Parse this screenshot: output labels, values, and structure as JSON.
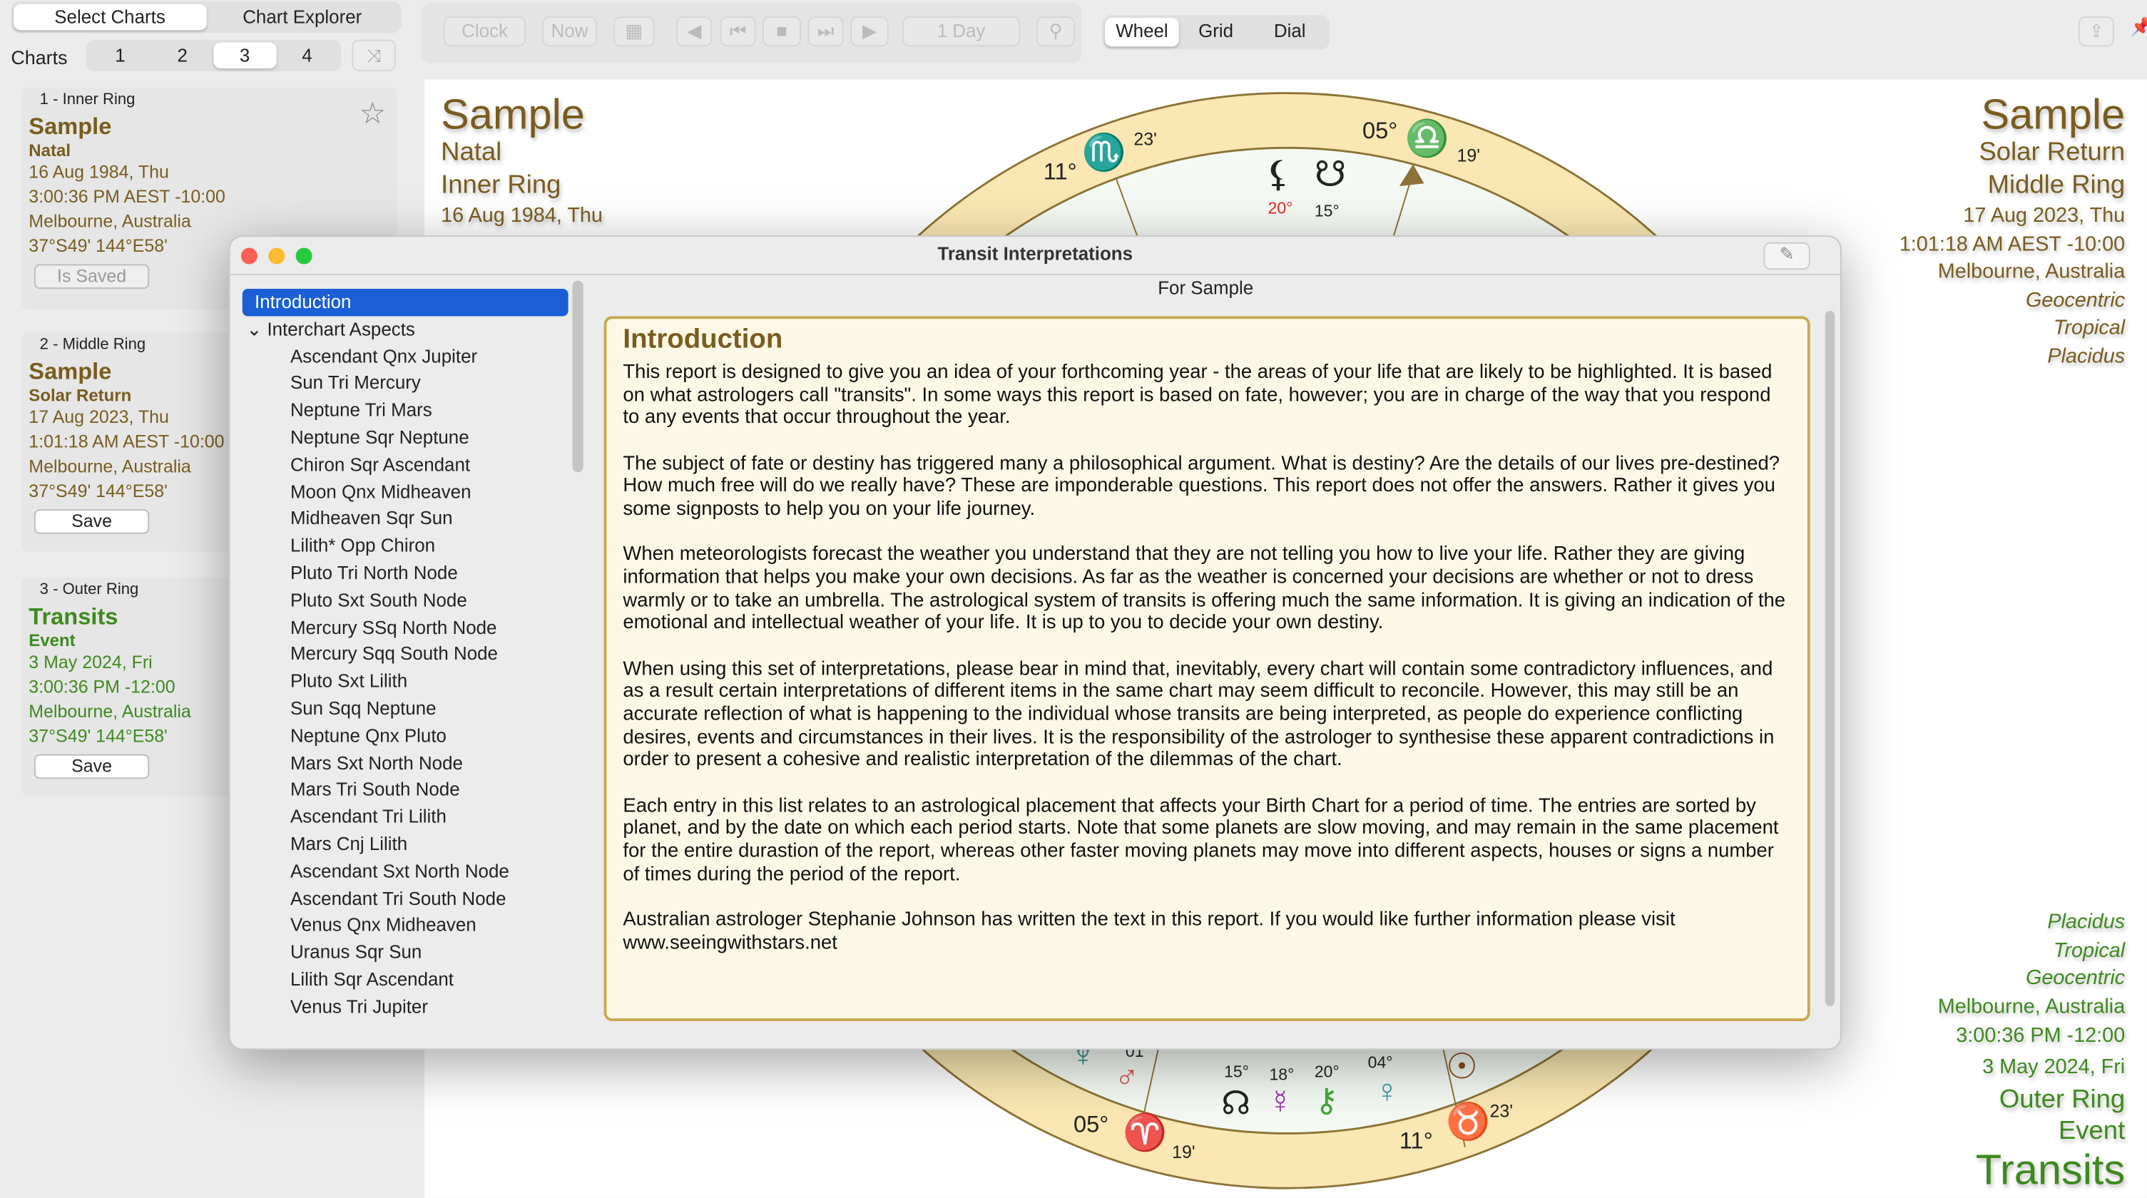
{
  "top_tabs": [
    "Select Charts",
    "Chart Explorer"
  ],
  "charts_label": "Charts",
  "chart_numbers": [
    "1",
    "2",
    "3",
    "4"
  ],
  "toolbar": {
    "clock": "Clock",
    "now": "Now",
    "step": "1 Day",
    "views": [
      "Wheel",
      "Grid",
      "Dial"
    ]
  },
  "cards": [
    {
      "ring": "1 - Inner Ring",
      "name": "Sample",
      "type": "Natal",
      "date": "16 Aug 1984, Thu",
      "time": "3:00:36 PM AEST -10:00",
      "place": "Melbourne, Australia",
      "coords": "37°S49' 144°E58'",
      "button": "Is Saved"
    },
    {
      "ring": "2 - Middle Ring",
      "name": "Sample",
      "type": "Solar Return",
      "date": "17 Aug 2023, Thu",
      "time": "1:01:18 AM AEST -10:00",
      "place": "Melbourne, Australia",
      "coords": "37°S49' 144°E58'",
      "button": "Save"
    },
    {
      "ring": "3 - Outer Ring",
      "name": "Transits",
      "type": "Event",
      "date": "3 May 2024, Fri",
      "time": "3:00:36 PM -12:00",
      "place": "Melbourne, Australia",
      "coords": "37°S49' 144°E58'",
      "button": "Save"
    }
  ],
  "left_title": {
    "name": "Sample",
    "type": "Natal",
    "ring": "Inner Ring",
    "date": "16 Aug 1984, Thu"
  },
  "right_top": {
    "name": "Sample",
    "type": "Solar Return",
    "ring": "Middle Ring",
    "date": "17 Aug 2023, Thu",
    "time": "1:01:18 AM AEST -10:00",
    "place": "Melbourne, Australia",
    "zodiac": "Geocentric",
    "mode": "Tropical",
    "houses": "Placidus"
  },
  "right_bottom": {
    "houses": "Placidus",
    "mode": "Tropical",
    "zodiac": "Geocentric",
    "place": "Melbourne, Australia",
    "time": "3:00:36 PM -12:00",
    "date": "3 May 2024, Fri",
    "ring": "Outer Ring",
    "type": "Event",
    "name": "Transits"
  },
  "wheel": {
    "top": [
      "11°",
      "23'",
      "05°",
      "19'",
      "20°",
      "15°"
    ],
    "bottom": [
      "05°",
      "19'",
      "11°",
      "23'",
      "15°",
      "18°",
      "20°",
      "04°",
      "01°"
    ]
  },
  "dialog": {
    "title": "Transit Interpretations",
    "subtitle": "For Sample",
    "list": [
      "Introduction",
      "Interchart Aspects",
      "Ascendant Qnx Jupiter",
      "Sun Tri Mercury",
      "Neptune Tri Mars",
      "Neptune Sqr Neptune",
      "Chiron Sqr Ascendant",
      "Moon Qnx Midheaven",
      "Midheaven Sqr Sun",
      "Lilith* Opp Chiron",
      "Pluto Tri North Node",
      "Pluto Sxt South Node",
      "Mercury SSq North Node",
      "Mercury Sqq South Node",
      "Pluto Sxt Lilith",
      "Sun Sqq Neptune",
      "Neptune Qnx Pluto",
      "Mars Sxt North Node",
      "Mars Tri South Node",
      "Ascendant Tri Lilith",
      "Mars Cnj Lilith",
      "Ascendant Sxt North Node",
      "Ascendant Tri South Node",
      "Venus Qnx Midheaven",
      "Uranus Sqr Sun",
      "Lilith Sqr Ascendant",
      "Venus Tri Jupiter"
    ],
    "heading": "Introduction",
    "paragraphs": [
      "This report is designed to give you an idea of your forthcoming year - the areas of your life that are likely to be highlighted. It is based on what astrologers call \"transits\". In some ways this report is based on fate, however; you are in charge of the way that you respond to any events that occur throughout the year.",
      "The subject of fate or destiny has triggered many a philosophical argument. What is destiny? Are the details of our lives pre-destined? How much free will do we really have? These are imponderable questions. This report does not offer the answers. Rather it gives you some signposts to help you on your life journey.",
      "When meteorologists forecast the weather you understand that they are not telling you how to live your life. Rather they are giving information that helps you make your own decisions. As far as the weather is concerned your decisions are whether or not to dress warmly or to take an umbrella. The astrological system of transits is offering much the same information. It is giving an indication of the emotional and intellectual weather of your life. It is up to you to decide your own destiny.",
      "When using this set of interpretations, please bear in mind that, inevitably, every chart will contain some contradictory influences, and as a result certain interpretations of different items in the same chart may seem difficult to reconcile. However, this may still be an accurate reflection of what is happening to the individual whose transits are being interpreted, as people do experience conflicting desires, events and circumstances in their lives. It is the responsibility of the astrologer to synthesise these apparent contradictions in order to present a cohesive and realistic interpretation of the dilemmas of the chart.",
      "Each entry in this list relates to an astrological placement that affects your Birth Chart for a period of time. The entries are sorted by planet, and by the date on which each period starts. Note that some planets are slow moving, and may remain in the same placement for the entire durastion of the report, whereas other faster moving planets may move into different aspects, houses or signs a number of times during the period of the report.",
      "Australian astrologer Stephanie Johnson has written the text in this report. If you would like further information please visit www.seeingwithstars.net"
    ]
  }
}
